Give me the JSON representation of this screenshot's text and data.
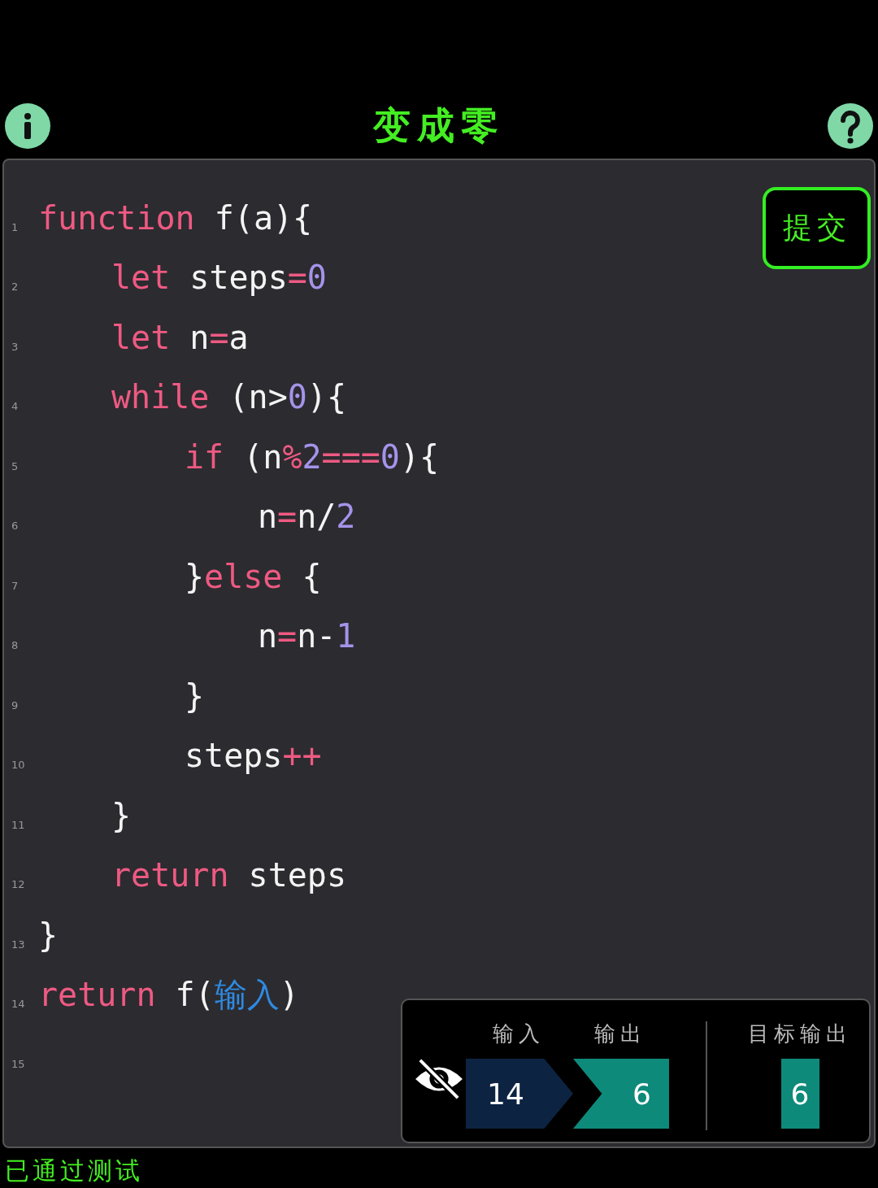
{
  "header": {
    "title": "变成零"
  },
  "submit_button": {
    "label": "提交"
  },
  "code": {
    "lines": [
      {
        "number": "1",
        "tokens": [
          {
            "kind": "keyword",
            "text": "function"
          },
          {
            "kind": "plain",
            "text": " f(a){"
          }
        ],
        "children": [
          {
            "number": "2",
            "tokens": [
              {
                "kind": "keyword",
                "text": "let"
              },
              {
                "kind": "plain",
                "text": " steps"
              },
              {
                "kind": "operator",
                "text": "="
              },
              {
                "kind": "number",
                "text": "0"
              }
            ]
          },
          {
            "number": "3",
            "tokens": [
              {
                "kind": "keyword",
                "text": "let"
              },
              {
                "kind": "plain",
                "text": " n"
              },
              {
                "kind": "operator",
                "text": "="
              },
              {
                "kind": "plain",
                "text": "a"
              }
            ]
          },
          {
            "number": "4",
            "tokens": [
              {
                "kind": "keyword",
                "text": "while"
              },
              {
                "kind": "plain",
                "text": " (n>"
              },
              {
                "kind": "number",
                "text": "0"
              },
              {
                "kind": "plain",
                "text": "){"
              }
            ],
            "children": [
              {
                "number": "5",
                "tokens": [
                  {
                    "kind": "keyword",
                    "text": "if"
                  },
                  {
                    "kind": "plain",
                    "text": " (n"
                  },
                  {
                    "kind": "operator",
                    "text": "%"
                  },
                  {
                    "kind": "number",
                    "text": "2"
                  },
                  {
                    "kind": "operator",
                    "text": "==="
                  },
                  {
                    "kind": "number",
                    "text": "0"
                  },
                  {
                    "kind": "plain",
                    "text": "){"
                  }
                ],
                "children": [
                  {
                    "number": "6",
                    "tokens": [
                      {
                        "kind": "plain",
                        "text": "n"
                      },
                      {
                        "kind": "operator",
                        "text": "="
                      },
                      {
                        "kind": "plain",
                        "text": "n/"
                      },
                      {
                        "kind": "number",
                        "text": "2"
                      }
                    ]
                  }
                ]
              },
              {
                "number": "7",
                "tokens": [
                  {
                    "kind": "plain",
                    "text": "}"
                  },
                  {
                    "kind": "keyword",
                    "text": "else"
                  },
                  {
                    "kind": "plain",
                    "text": " {"
                  }
                ],
                "children": [
                  {
                    "number": "8",
                    "tokens": [
                      {
                        "kind": "plain",
                        "text": "n"
                      },
                      {
                        "kind": "operator",
                        "text": "="
                      },
                      {
                        "kind": "plain",
                        "text": "n-"
                      },
                      {
                        "kind": "number",
                        "text": "1"
                      }
                    ]
                  }
                ]
              },
              {
                "number": "9",
                "tokens": [
                  {
                    "kind": "plain",
                    "text": "}"
                  }
                ]
              },
              {
                "number": "10",
                "tokens": [
                  {
                    "kind": "plain",
                    "text": "steps"
                  },
                  {
                    "kind": "operator",
                    "text": "++"
                  }
                ]
              }
            ]
          },
          {
            "number": "11",
            "tokens": [
              {
                "kind": "plain",
                "text": "}"
              }
            ]
          },
          {
            "number": "12",
            "tokens": [
              {
                "kind": "keyword",
                "text": "return"
              },
              {
                "kind": "plain",
                "text": " steps"
              }
            ]
          }
        ]
      },
      {
        "number": "13",
        "tokens": [
          {
            "kind": "plain",
            "text": "}"
          }
        ]
      },
      {
        "number": "14",
        "tokens": [
          {
            "kind": "keyword",
            "text": "return"
          },
          {
            "kind": "plain",
            "text": " f("
          },
          {
            "kind": "variable",
            "text": "输入"
          },
          {
            "kind": "plain",
            "text": ")"
          }
        ]
      },
      {
        "number": "15"
      }
    ]
  },
  "result_panel": {
    "input": {
      "label": "输入",
      "value": "14"
    },
    "output": {
      "label": "输出",
      "value": "6"
    },
    "target": {
      "label": "目标输出",
      "value": "6"
    }
  },
  "status": "已通过测试"
}
